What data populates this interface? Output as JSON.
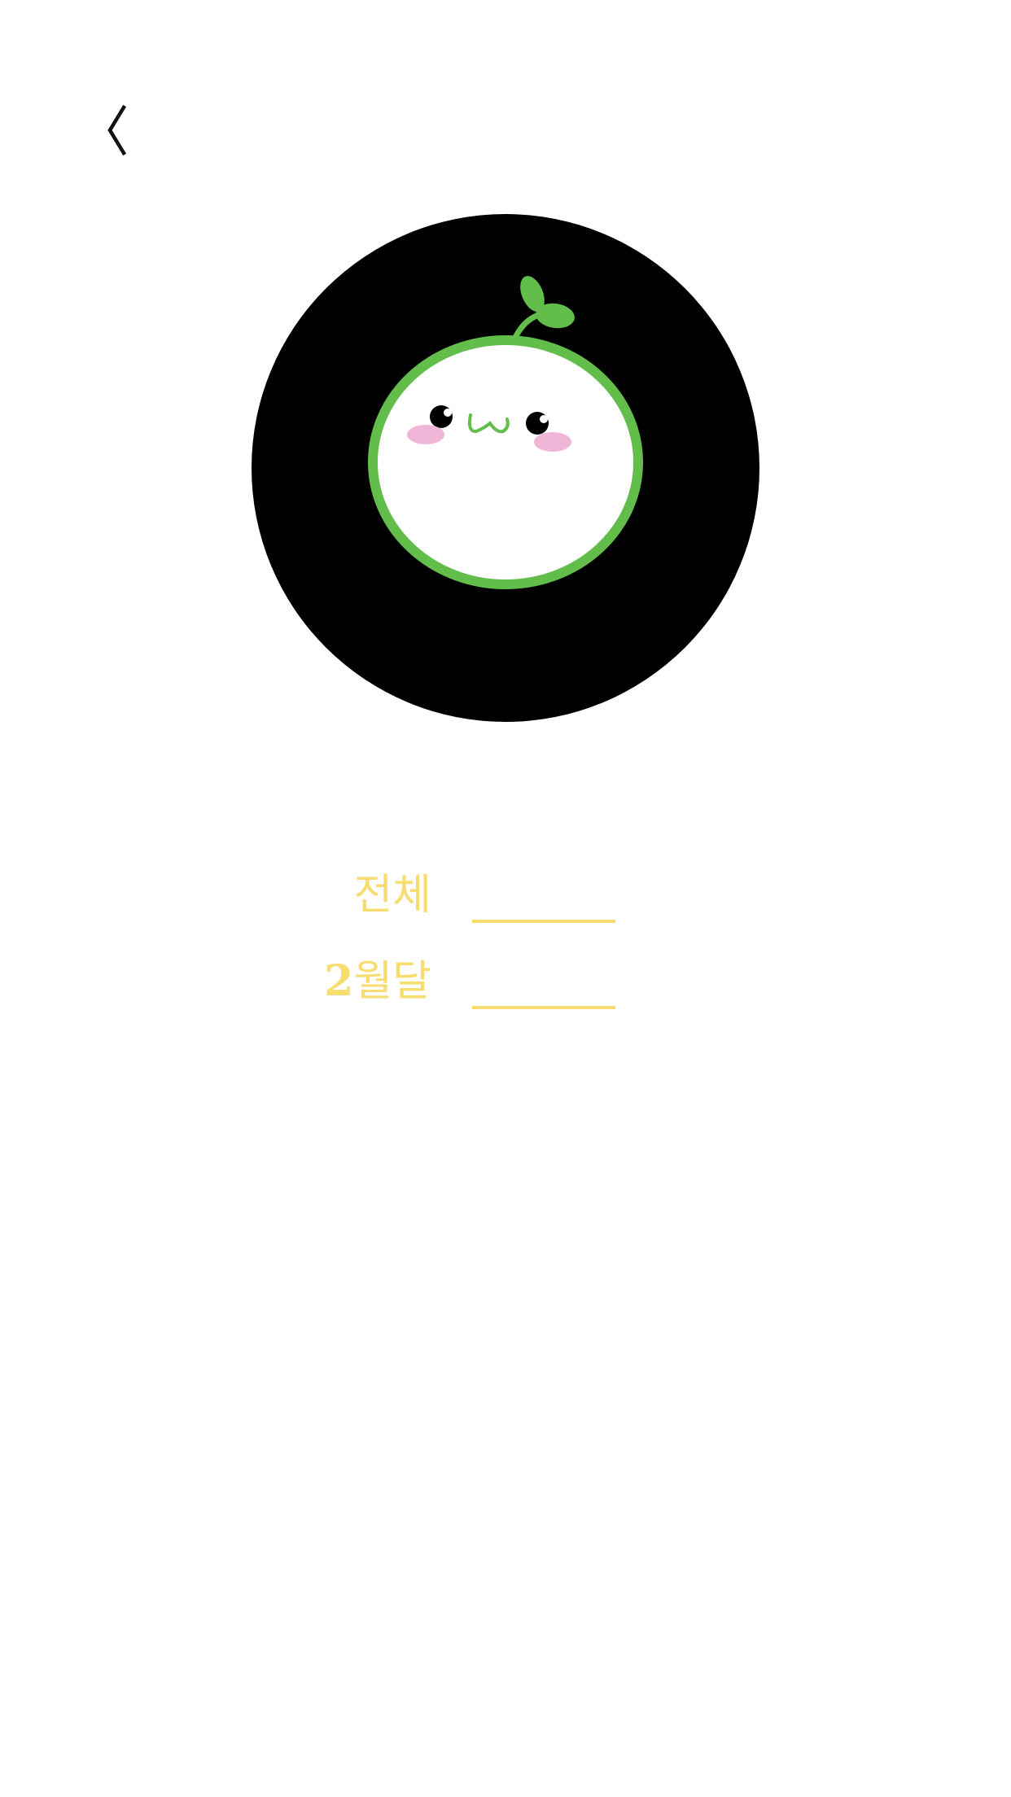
{
  "nav": {
    "back_icon": "chevron-left-icon"
  },
  "avatar": {
    "icon": "sprout-mascot-icon",
    "background_color": "#000000",
    "outline_color": "#63bd4b",
    "blush_color": "#efb6d8"
  },
  "stats": {
    "total": {
      "label": "전체",
      "value": ""
    },
    "monthly": {
      "month_number": "2",
      "label_suffix": "월달",
      "value": ""
    }
  },
  "colors": {
    "accent": "#f7dc6f",
    "leaf": "#63bd4b"
  }
}
